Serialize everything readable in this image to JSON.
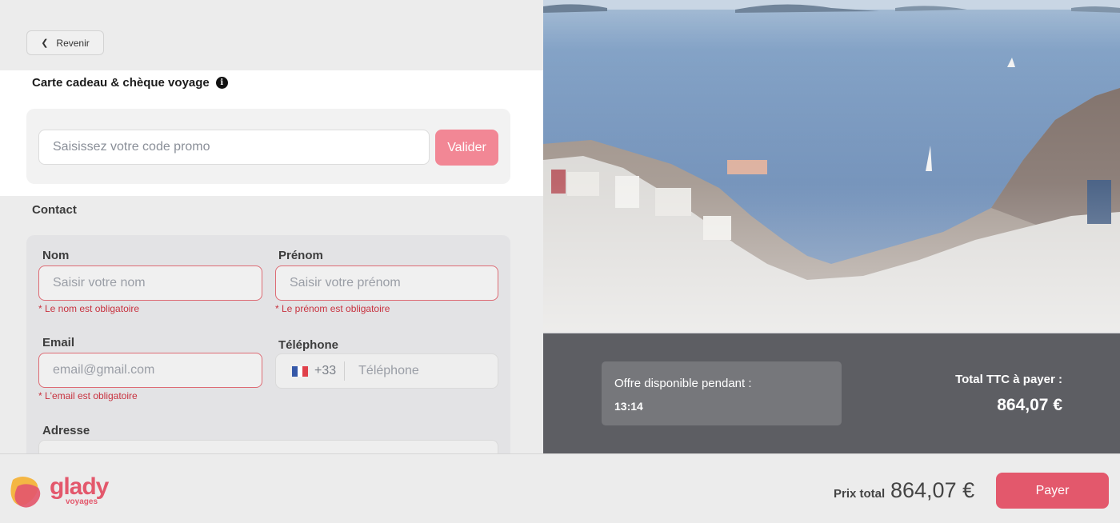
{
  "nav": {
    "back_label": "Revenir"
  },
  "gift": {
    "title": "Carte cadeau & chèque voyage",
    "info_icon": "info-circle-icon",
    "promo_placeholder": "Saisissez votre code promo",
    "promo_value": "",
    "validate_label": "Valider"
  },
  "contact": {
    "title": "Contact",
    "last_name": {
      "label": "Nom",
      "placeholder": "Saisir votre nom",
      "value": "",
      "error": "* Le nom est obligatoire"
    },
    "first_name": {
      "label": "Prénom",
      "placeholder": "Saisir votre prénom",
      "value": "",
      "error": "* Le prénom est obligatoire"
    },
    "email": {
      "label": "Email",
      "placeholder": "email@gmail.com",
      "value": "",
      "error": "* L'email est obligatoire"
    },
    "phone": {
      "label": "Téléphone",
      "dial_code": "+33",
      "placeholder": "Téléphone",
      "value": "",
      "flag": "france-flag-icon"
    },
    "address": {
      "label": "Adresse"
    }
  },
  "summary": {
    "offer_label": "Offre disponible pendant :",
    "offer_timer": "13:14",
    "total_label": "Total TTC à payer :",
    "total_value": "864,07 €"
  },
  "footer": {
    "brand": "glady",
    "brand_sub": "voyages",
    "price_label": "Prix total",
    "price_value": "864,07 €",
    "pay_label": "Payer"
  },
  "colors": {
    "accent": "#e3586c",
    "accent_light": "#f28795",
    "error": "#c8323f",
    "summary_bg": "#5d5e63",
    "offer_card_bg": "#76777b"
  }
}
